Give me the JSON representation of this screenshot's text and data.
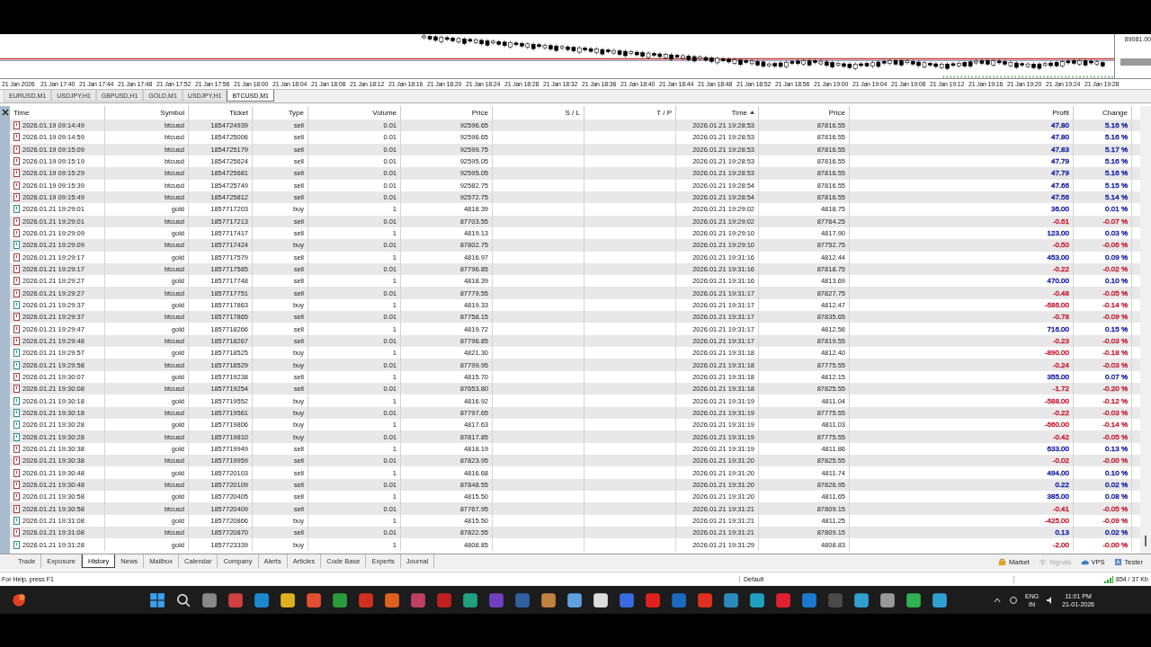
{
  "chart": {
    "price_label": "89081.00",
    "time_labels": [
      "21 Jan 2026",
      "21 Jan 17:40",
      "21 Jan 17:44",
      "21 Jan 17:48",
      "21 Jan 17:52",
      "21 Jan 17:56",
      "21 Jan 18:00",
      "21 Jan 18:04",
      "21 Jan 18:08",
      "21 Jan 18:12",
      "21 Jan 18:16",
      "21 Jan 18:20",
      "21 Jan 18:24",
      "21 Jan 18:28",
      "21 Jan 18:32",
      "21 Jan 18:36",
      "21 Jan 18:40",
      "21 Jan 18:44",
      "21 Jan 18:48",
      "21 Jan 18:52",
      "21 Jan 18:56",
      "21 Jan 19:00",
      "21 Jan 19:04",
      "21 Jan 19:08",
      "21 Jan 19:12",
      "21 Jan 19:16",
      "21 Jan 19:20",
      "21 Jan 19:24",
      "21 Jan 19:28"
    ]
  },
  "chart_tabs": [
    {
      "label": "EURUSD,M1",
      "selected": false
    },
    {
      "label": "USDJPY,H1",
      "selected": false
    },
    {
      "label": "GBPUSD,H1",
      "selected": false
    },
    {
      "label": "GOLD,M1",
      "selected": false
    },
    {
      "label": "USDJPY,H1",
      "selected": false
    },
    {
      "label": "BTCUSD,M1",
      "selected": true
    }
  ],
  "table": {
    "columns": [
      {
        "label": "Time",
        "kind": "text",
        "sorted": false
      },
      {
        "label": "Symbol",
        "kind": "text",
        "sorted": false
      },
      {
        "label": "Ticket",
        "kind": "text",
        "sorted": false
      },
      {
        "label": "Type",
        "kind": "text",
        "sorted": false
      },
      {
        "label": "Volume",
        "kind": "text",
        "sorted": false
      },
      {
        "label": "Price",
        "kind": "text",
        "sorted": false
      },
      {
        "label": "S / L",
        "kind": "text",
        "sorted": false
      },
      {
        "label": "T / P",
        "kind": "text",
        "sorted": false
      },
      {
        "label": "Time",
        "kind": "text",
        "sorted": true
      },
      {
        "label": "Price",
        "kind": "text",
        "sorted": false
      },
      {
        "label": "Profit",
        "kind": "result",
        "sorted": false
      },
      {
        "label": "Change",
        "kind": "result",
        "sorted": false
      }
    ],
    "rows": [
      {
        "kind": "sell",
        "color": "#1f2aa8",
        "cells": [
          "2026.01.19 09:14:49",
          "btcusd",
          "1854724939",
          "sell",
          "0.01",
          "92596.65",
          "",
          "",
          "2026.01.21 19:28:53",
          "87816.55",
          "47.80",
          "5.16 %"
        ]
      },
      {
        "kind": "sell",
        "color": "#1f2aa8",
        "cells": [
          "2026.01.19 09:14:59",
          "btcusd",
          "1854725006",
          "sell",
          "0.01",
          "92596.65",
          "",
          "",
          "2026.01.21 19:28:53",
          "87816.55",
          "47.80",
          "5.16 %"
        ]
      },
      {
        "kind": "sell",
        "color": "#1f2aa8",
        "cells": [
          "2026.01.19 09:15:09",
          "btcusd",
          "1854725179",
          "sell",
          "0.01",
          "92599.75",
          "",
          "",
          "2026.01.21 19:28:53",
          "87816.55",
          "47.83",
          "5.17 %"
        ]
      },
      {
        "kind": "sell",
        "color": "#1f2aa8",
        "cells": [
          "2026.01.19 09:15:19",
          "btcusd",
          "1854725624",
          "sell",
          "0.01",
          "92595.05",
          "",
          "",
          "2026.01.21 19:28:53",
          "87816.55",
          "47.79",
          "5.16 %"
        ]
      },
      {
        "kind": "sell",
        "color": "#1f2aa8",
        "cells": [
          "2026.01.19 09:15:29",
          "btcusd",
          "1854725681",
          "sell",
          "0.01",
          "92595.05",
          "",
          "",
          "2026.01.21 19:28:53",
          "87816.55",
          "47.79",
          "5.16 %"
        ]
      },
      {
        "kind": "sell",
        "color": "#1f2aa8",
        "cells": [
          "2026.01.19 09:15:39",
          "btcusd",
          "1854725749",
          "sell",
          "0.01",
          "92582.75",
          "",
          "",
          "2026.01.21 19:28:54",
          "87816.55",
          "47.66",
          "5.15 %"
        ]
      },
      {
        "kind": "sell",
        "color": "#1f2aa8",
        "cells": [
          "2026.01.19 09:15:49",
          "btcusd",
          "1854725812",
          "sell",
          "0.01",
          "92572.75",
          "",
          "",
          "2026.01.21 19:28:54",
          "87816.55",
          "47.56",
          "5.14 %"
        ]
      },
      {
        "kind": "buy",
        "color": "#1f2aa8",
        "cells": [
          "2026.01.21 19:29:01",
          "gold",
          "1857717203",
          "buy",
          "1",
          "4818.39",
          "",
          "",
          "2026.01.21 19:29:02",
          "4818.75",
          "36.00",
          "0.01 %"
        ]
      },
      {
        "kind": "sell",
        "color": "#c8283c",
        "cells": [
          "2026.01.21 19:29:01",
          "btcusd",
          "1857717213",
          "sell",
          "0.01",
          "87703.55",
          "",
          "",
          "2026.01.21 19:29:02",
          "87764.25",
          "-0.61",
          "-0.07 %"
        ]
      },
      {
        "kind": "sell",
        "color": "#1f2aa8",
        "cells": [
          "2026.01.21 19:29:09",
          "gold",
          "1857717417",
          "sell",
          "1",
          "4819.13",
          "",
          "",
          "2026.01.21 19:29:10",
          "4817.90",
          "123.00",
          "0.03 %"
        ]
      },
      {
        "kind": "buy",
        "color": "#c8283c",
        "cells": [
          "2026.01.21 19:29:09",
          "btcusd",
          "1857717424",
          "buy",
          "0.01",
          "87802.75",
          "",
          "",
          "2026.01.21 19:29:10",
          "87752.75",
          "-0.50",
          "-0.06 %"
        ]
      },
      {
        "kind": "sell",
        "color": "#1f2aa8",
        "cells": [
          "2026.01.21 19:29:17",
          "gold",
          "1857717579",
          "sell",
          "1",
          "4816.97",
          "",
          "",
          "2026.01.21 19:31:16",
          "4812.44",
          "453.00",
          "0.09 %"
        ]
      },
      {
        "kind": "sell",
        "color": "#c8283c",
        "cells": [
          "2026.01.21 19:29:17",
          "btcusd",
          "1857717585",
          "sell",
          "0.01",
          "87796.85",
          "",
          "",
          "2026.01.21 19:31:16",
          "87818.75",
          "-0.22",
          "-0.02 %"
        ]
      },
      {
        "kind": "sell",
        "color": "#1f2aa8",
        "cells": [
          "2026.01.21 19:29:27",
          "gold",
          "1857717748",
          "sell",
          "1",
          "4818.39",
          "",
          "",
          "2026.01.21 19:31:16",
          "4813.69",
          "470.00",
          "0.10 %"
        ]
      },
      {
        "kind": "sell",
        "color": "#c8283c",
        "cells": [
          "2026.01.21 19:29:27",
          "btcusd",
          "1857717751",
          "sell",
          "0.01",
          "87779.55",
          "",
          "",
          "2026.01.21 19:31:17",
          "87827.75",
          "-0.48",
          "-0.05 %"
        ]
      },
      {
        "kind": "buy",
        "color": "#c8283c",
        "cells": [
          "2026.01.21 19:29:37",
          "gold",
          "1857717863",
          "buy",
          "1",
          "4819.33",
          "",
          "",
          "2026.01.21 19:31:17",
          "4812.47",
          "-686.00",
          "-0.14 %"
        ]
      },
      {
        "kind": "sell",
        "color": "#c8283c",
        "cells": [
          "2026.01.21 19:29:37",
          "btcusd",
          "1857717865",
          "sell",
          "0.01",
          "87758.15",
          "",
          "",
          "2026.01.21 19:31:17",
          "87835.65",
          "-0.78",
          "-0.09 %"
        ]
      },
      {
        "kind": "sell",
        "color": "#1f2aa8",
        "cells": [
          "2026.01.21 19:29:47",
          "gold",
          "1857718266",
          "sell",
          "1",
          "4819.72",
          "",
          "",
          "2026.01.21 19:31:17",
          "4812.56",
          "716.00",
          "0.15 %"
        ]
      },
      {
        "kind": "sell",
        "color": "#c8283c",
        "cells": [
          "2026.01.21 19:29:48",
          "btcusd",
          "1857718267",
          "sell",
          "0.01",
          "87796.85",
          "",
          "",
          "2026.01.21 19:31:17",
          "87819.55",
          "-0.23",
          "-0.03 %"
        ]
      },
      {
        "kind": "buy",
        "color": "#c8283c",
        "cells": [
          "2026.01.21 19:29:57",
          "gold",
          "1857718525",
          "buy",
          "1",
          "4821.30",
          "",
          "",
          "2026.01.21 19:31:18",
          "4812.40",
          "-890.00",
          "-0.18 %"
        ]
      },
      {
        "kind": "buy",
        "color": "#c8283c",
        "cells": [
          "2026.01.21 19:29:58",
          "btcusd",
          "1857718529",
          "buy",
          "0.01",
          "87799.95",
          "",
          "",
          "2026.01.21 19:31:18",
          "87775.55",
          "-0.24",
          "-0.03 %"
        ]
      },
      {
        "kind": "sell",
        "color": "#1f2aa8",
        "cells": [
          "2026.01.21 19:30:07",
          "gold",
          "1857719238",
          "sell",
          "1",
          "4815.70",
          "",
          "",
          "2026.01.21 19:31:18",
          "4812.15",
          "355.00",
          "0.07 %"
        ]
      },
      {
        "kind": "sell",
        "color": "#c8283c",
        "cells": [
          "2026.01.21 19:30:08",
          "btcusd",
          "1857719254",
          "sell",
          "0.01",
          "87653.80",
          "",
          "",
          "2026.01.21 19:31:18",
          "87825.55",
          "-1.72",
          "-0.20 %"
        ]
      },
      {
        "kind": "buy",
        "color": "#c8283c",
        "cells": [
          "2026.01.21 19:30:18",
          "gold",
          "1857719552",
          "buy",
          "1",
          "4816.92",
          "",
          "",
          "2026.01.21 19:31:19",
          "4811.04",
          "-588.00",
          "-0.12 %"
        ]
      },
      {
        "kind": "buy",
        "color": "#c8283c",
        "cells": [
          "2026.01.21 19:30:18",
          "btcusd",
          "1857719561",
          "buy",
          "0.01",
          "87797.65",
          "",
          "",
          "2026.01.21 19:31:19",
          "87775.55",
          "-0.22",
          "-0.03 %"
        ]
      },
      {
        "kind": "buy",
        "color": "#c8283c",
        "cells": [
          "2026.01.21 19:30:28",
          "gold",
          "1857719806",
          "buy",
          "1",
          "4817.63",
          "",
          "",
          "2026.01.21 19:31:19",
          "4811.03",
          "-660.00",
          "-0.14 %"
        ]
      },
      {
        "kind": "buy",
        "color": "#c8283c",
        "cells": [
          "2026.01.21 19:30:28",
          "btcusd",
          "1857719810",
          "buy",
          "0.01",
          "87817.85",
          "",
          "",
          "2026.01.21 19:31:19",
          "87775.55",
          "-0.42",
          "-0.05 %"
        ]
      },
      {
        "kind": "sell",
        "color": "#1f2aa8",
        "cells": [
          "2026.01.21 19:30:38",
          "gold",
          "1857719949",
          "sell",
          "1",
          "4818.19",
          "",
          "",
          "2026.01.21 19:31:19",
          "4811.86",
          "633.00",
          "0.13 %"
        ]
      },
      {
        "kind": "sell",
        "color": "#c8283c",
        "cells": [
          "2026.01.21 19:30:38",
          "btcusd",
          "1857719959",
          "sell",
          "0.01",
          "87823.95",
          "",
          "",
          "2026.01.21 19:31:20",
          "87825.55",
          "-0.02",
          "-0.00 %"
        ]
      },
      {
        "kind": "sell",
        "color": "#1f2aa8",
        "cells": [
          "2026.01.21 19:30:48",
          "gold",
          "1857720103",
          "sell",
          "1",
          "4816.68",
          "",
          "",
          "2026.01.21 19:31:20",
          "4811.74",
          "494.00",
          "0.10 %"
        ]
      },
      {
        "kind": "sell",
        "color": "#1f2aa8",
        "cells": [
          "2026.01.21 19:30:48",
          "btcusd",
          "1857720109",
          "sell",
          "0.01",
          "87848.55",
          "",
          "",
          "2026.01.21 19:31:20",
          "87826.95",
          "0.22",
          "0.02 %"
        ]
      },
      {
        "kind": "sell",
        "color": "#1f2aa8",
        "cells": [
          "2026.01.21 19:30:58",
          "gold",
          "1857720405",
          "sell",
          "1",
          "4815.50",
          "",
          "",
          "2026.01.21 19:31:20",
          "4811.65",
          "385.00",
          "0.08 %"
        ]
      },
      {
        "kind": "sell",
        "color": "#c8283c",
        "cells": [
          "2026.01.21 19:30:58",
          "btcusd",
          "1857720409",
          "sell",
          "0.01",
          "87767.95",
          "",
          "",
          "2026.01.21 19:31:21",
          "87809.15",
          "-0.41",
          "-0.05 %"
        ]
      },
      {
        "kind": "buy",
        "color": "#c8283c",
        "cells": [
          "2026.01.21 19:31:08",
          "gold",
          "1857720866",
          "buy",
          "1",
          "4815.50",
          "",
          "",
          "2026.01.21 19:31:21",
          "4811.25",
          "-425.00",
          "-0.09 %"
        ]
      },
      {
        "kind": "sell",
        "color": "#1f2aa8",
        "cells": [
          "2026.01.21 19:31:08",
          "btcusd",
          "1857720870",
          "sell",
          "0.01",
          "87822.55",
          "",
          "",
          "2026.01.21 19:31:21",
          "87809.15",
          "0.13",
          "0.02 %"
        ]
      },
      {
        "kind": "buy",
        "color": "#c8283c",
        "cells": [
          "2026.01.21 19:31:28",
          "gold",
          "1857723339",
          "buy",
          "1",
          "4808.85",
          "",
          "",
          "2026.01.21 19:31:29",
          "4808.83",
          "-2.00",
          "-0.00 %"
        ]
      }
    ]
  },
  "toolbox_tabs": [
    {
      "label": "Trade",
      "selected": false
    },
    {
      "label": "Exposure",
      "selected": false
    },
    {
      "label": "History",
      "selected": true
    },
    {
      "label": "News",
      "selected": false
    },
    {
      "label": "Mailbox",
      "selected": false
    },
    {
      "label": "Calendar",
      "selected": false
    },
    {
      "label": "Company",
      "selected": false
    },
    {
      "label": "Alerts",
      "selected": false
    },
    {
      "label": "Articles",
      "selected": false
    },
    {
      "label": "Code Base",
      "selected": false
    },
    {
      "label": "Experts",
      "selected": false
    },
    {
      "label": "Journal",
      "selected": false
    }
  ],
  "toolbox_buttons": [
    {
      "label": "Market",
      "kind": "market",
      "disabled": false
    },
    {
      "label": "Signals",
      "kind": "signals",
      "disabled": true
    },
    {
      "label": "VPS",
      "kind": "vps",
      "disabled": false
    },
    {
      "label": "Tester",
      "kind": "tester",
      "disabled": false
    }
  ],
  "status_bar": {
    "help": "For Help, press F1",
    "profile": "Default",
    "traffic": "854 / 37 Kb"
  },
  "taskbar": {
    "language": "ENG",
    "region": "IN",
    "time": "11:01 PM",
    "date": "21-01-2026"
  }
}
